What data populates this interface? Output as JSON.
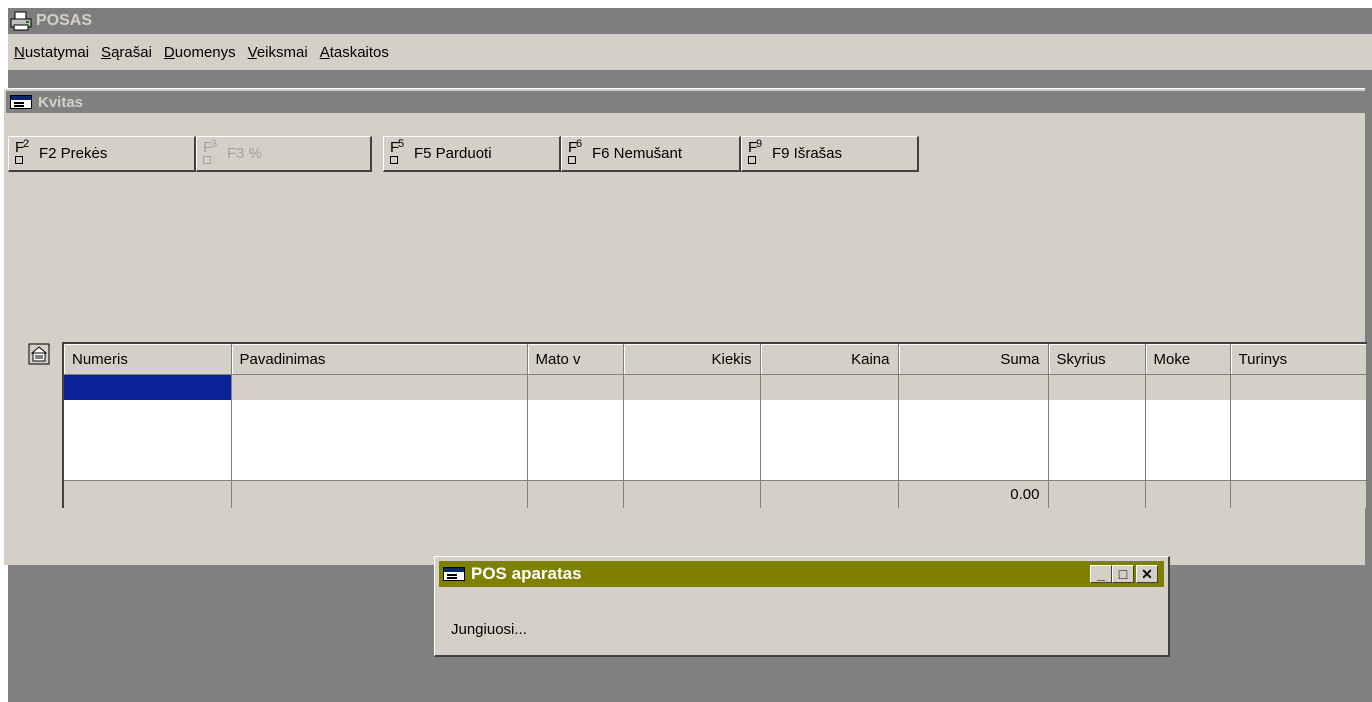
{
  "app": {
    "title": "POSAS"
  },
  "menu": [
    {
      "accel": "N",
      "rest": "ustatymai"
    },
    {
      "accel": "S",
      "rest": "ąrašai"
    },
    {
      "accel": "D",
      "rest": "uomenys"
    },
    {
      "accel": "V",
      "rest": "eiksmai"
    },
    {
      "accel": "A",
      "rest": "taskaitos"
    }
  ],
  "child": {
    "title": "Kvitas"
  },
  "toolbar": {
    "buttons": [
      {
        "key": "2",
        "label": "F2 Prekės"
      },
      {
        "key": "3",
        "label": "F3 %"
      },
      {
        "key": "5",
        "label": "F5 Parduoti"
      },
      {
        "key": "6",
        "label": "F6 Nemušant"
      },
      {
        "key": "9",
        "label": "F9 Išrašas"
      }
    ]
  },
  "grid": {
    "columns": [
      "Numeris",
      "Pavadinimas",
      "Mato v",
      "Kiekis",
      "Kaina",
      "Suma",
      "Skyrius",
      "Moke",
      "Turinys"
    ],
    "total_suma": "0.00"
  },
  "dialog": {
    "title": "POS aparatas",
    "message": "Jungiuosi...",
    "min": "_",
    "max": "□",
    "close": "✕"
  },
  "colors": {
    "selection": "#0a2299",
    "dialog_title": "#808000",
    "inactive_title": "#808080"
  }
}
